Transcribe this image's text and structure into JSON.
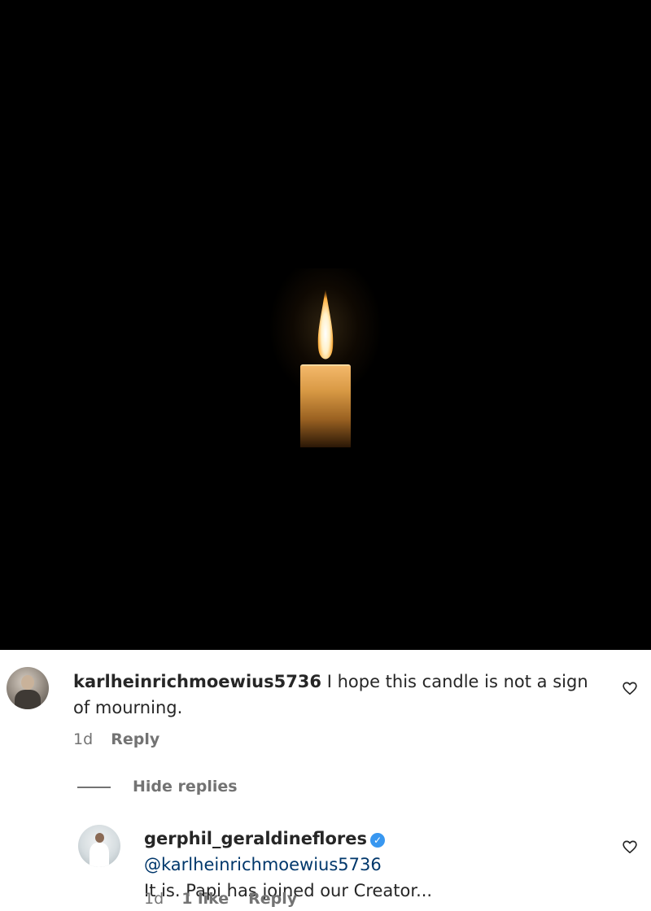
{
  "post": {
    "image_subject": "candle-icon"
  },
  "comment": {
    "username": "karlheinrichmoewius5736",
    "text": " I hope this candle is not a sign of mourning.",
    "time": "1d",
    "reply_label": "Reply"
  },
  "hide_replies_label": "Hide replies",
  "reply": {
    "username": "gerphil_geraldineflores",
    "mention": "@karlheinrichmoewius5736",
    "text": "It is. Papi has joined our Creator...",
    "time": "1d",
    "likes": "1 like",
    "reply_label": "Reply"
  },
  "colors": {
    "mention": "#00376b",
    "meta": "#737373",
    "verified": "#3897f0"
  }
}
